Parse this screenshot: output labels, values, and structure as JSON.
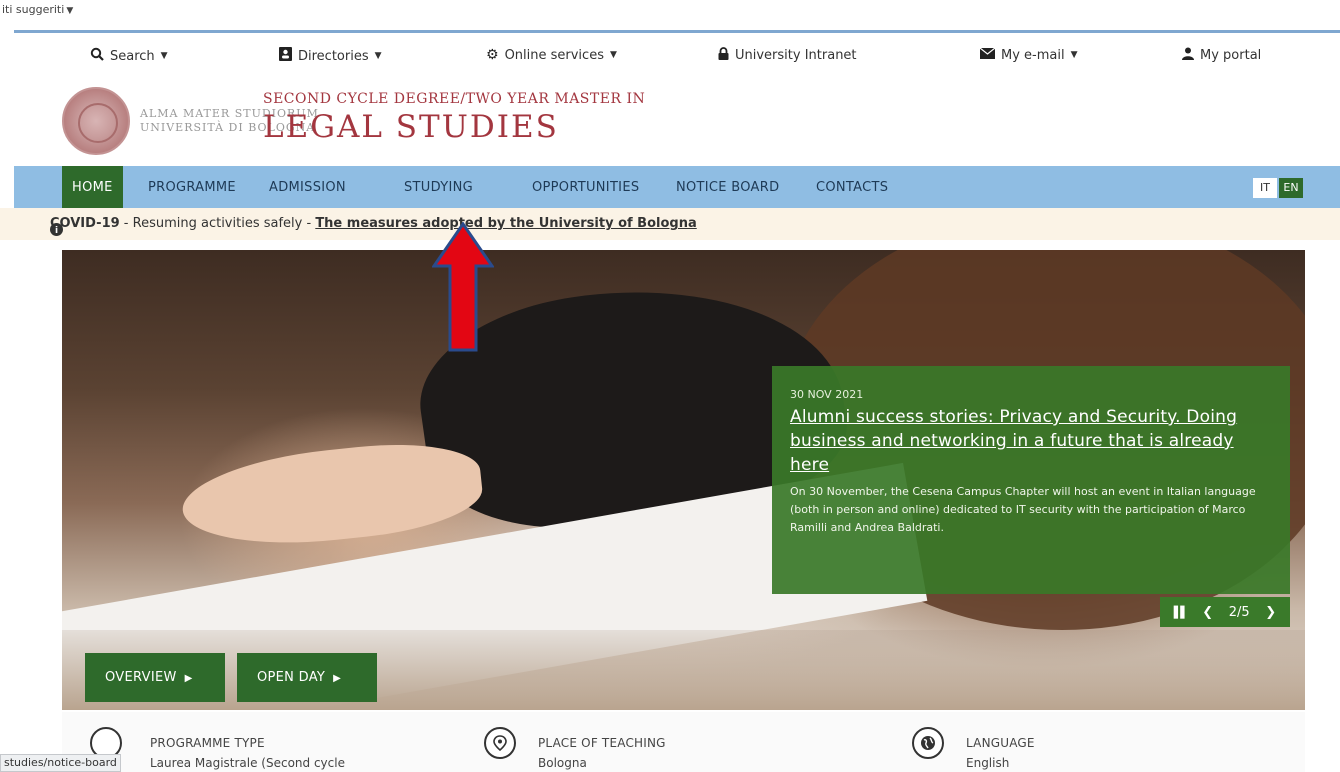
{
  "bookmarks": {
    "label": "iti suggeriti"
  },
  "utility": {
    "search": "Search",
    "directories": "Directories",
    "online_services": "Online services",
    "intranet": "University Intranet",
    "email": "My e-mail",
    "portal": "My portal"
  },
  "header": {
    "alma_line1": "ALMA MATER STUDIORUM",
    "alma_line2": "UNIVERSITÀ DI BOLOGNA",
    "degree_subtitle": "SECOND CYCLE DEGREE/TWO YEAR MASTER IN",
    "degree_title": "LEGAL STUDIES"
  },
  "nav": {
    "items": [
      "HOME",
      "PROGRAMME",
      "ADMISSION",
      "STUDYING",
      "OPPORTUNITIES",
      "NOTICE BOARD",
      "CONTACTS"
    ],
    "active": "HOME",
    "lang_it": "IT",
    "lang_en": "EN"
  },
  "covid": {
    "bold": "COVID-19",
    "text": " - Resuming activities safely - ",
    "link": "The measures adopted by the University of Bologna"
  },
  "news": {
    "date": "30 NOV 2021",
    "title": "Alumni success stories: Privacy and Security. Doing business and networking in a future that is already here",
    "body": "On 30 November, the Cesena Campus Chapter will host an event in Italian language (both in person and online) dedicated to IT security with the participation of Marco Ramilli and Andrea Baldrati."
  },
  "slider": {
    "counter": "2/5"
  },
  "hero_buttons": {
    "overview": "OVERVIEW",
    "open_day": "OPEN DAY"
  },
  "info": {
    "type_head": "PROGRAMME TYPE",
    "type_val": "Laurea Magistrale (Second cycle",
    "place_head": "PLACE OF TEACHING",
    "place_val": "Bologna",
    "lang_head": "LANGUAGE",
    "lang_val": "English"
  },
  "statusbar": {
    "url": "studies/notice-board"
  },
  "colors": {
    "nav_bg": "#8fbde3",
    "active_green": "#2e6a2b",
    "brand_red": "#a3363f",
    "annotation_arrow": "#e30613"
  }
}
